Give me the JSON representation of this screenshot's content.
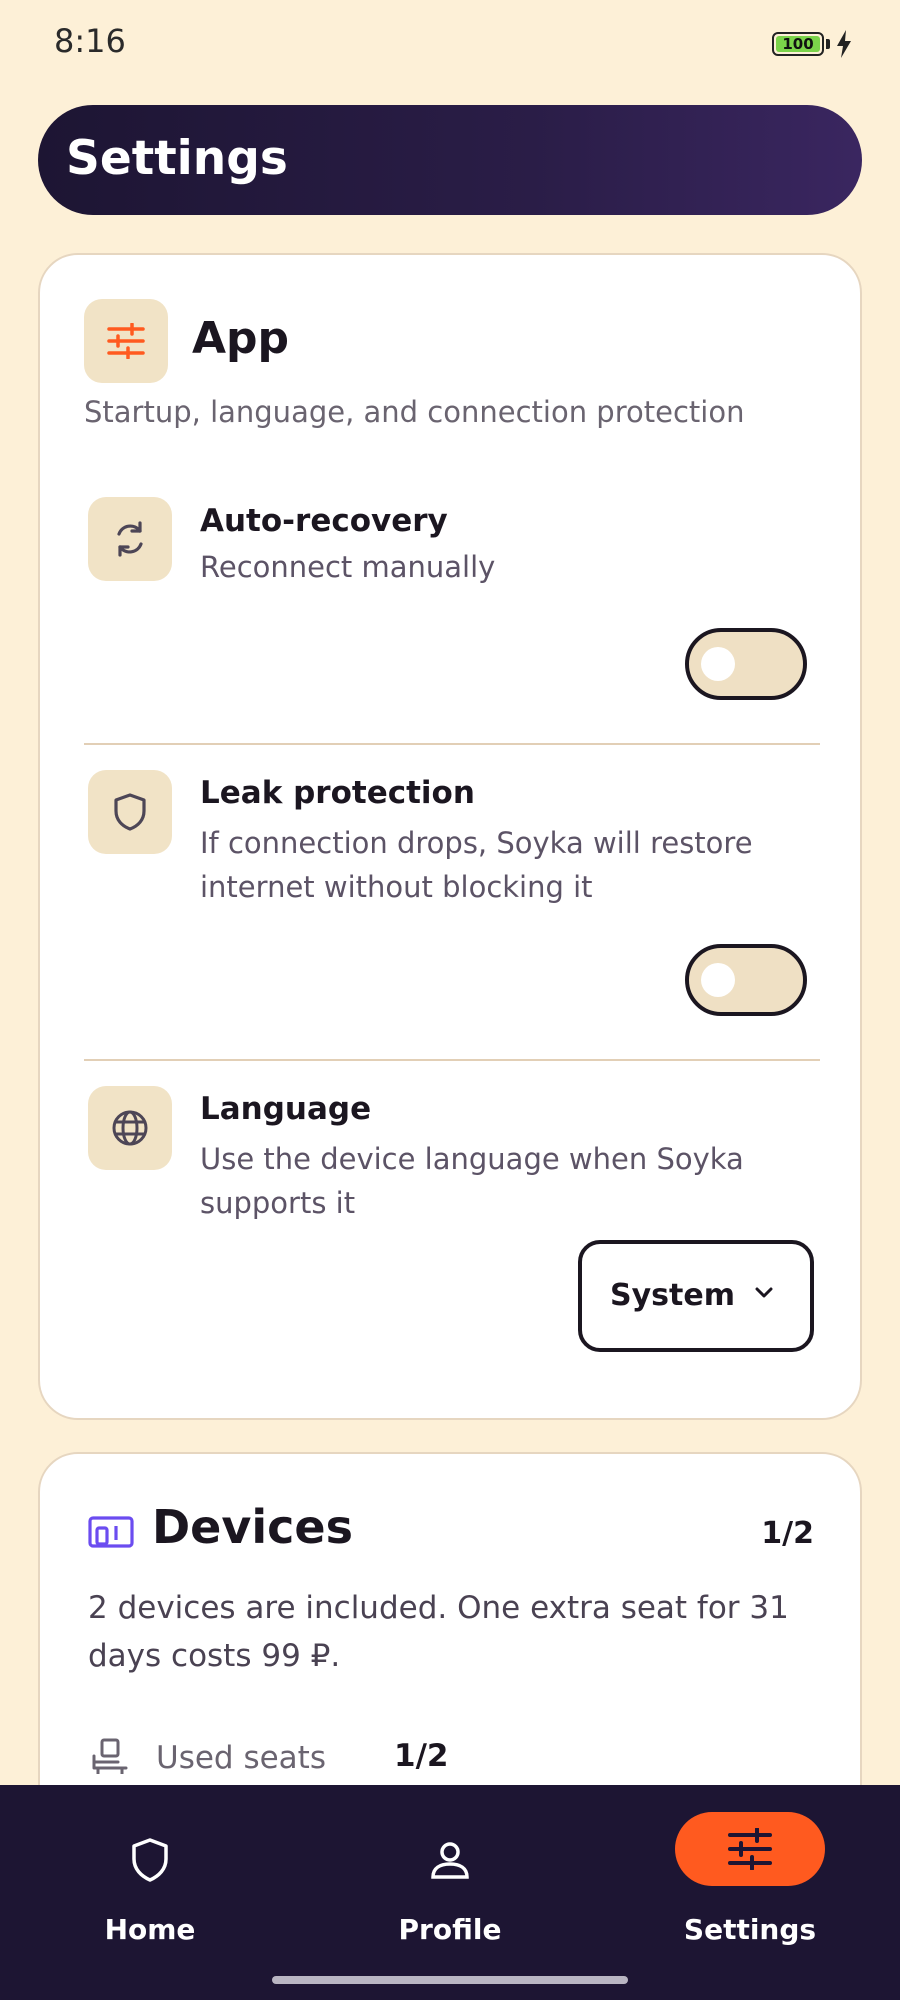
{
  "status_bar": {
    "time": "8:16",
    "battery": "100"
  },
  "header": {
    "title": "Settings"
  },
  "app_section": {
    "title": "App",
    "subtitle": "Startup, language, and connection protection",
    "settings": [
      {
        "title": "Auto-recovery",
        "description": "Reconnect manually",
        "toggle_on": false
      },
      {
        "title": "Leak protection",
        "description": "If connection drops, Soyka will restore internet without blocking it",
        "toggle_on": false
      },
      {
        "title": "Language",
        "description": "Use the device language when Soyka supports it",
        "selected": "System"
      }
    ]
  },
  "devices_section": {
    "title": "Devices",
    "count": "1/2",
    "description": "2 devices are included. One extra seat for 31 days costs 99 ₽.",
    "used_seats_label": "Used seats",
    "used_seats_value": "1/2"
  },
  "bottom_nav": {
    "items": [
      {
        "label": "Home",
        "icon": "shield-icon",
        "active": false
      },
      {
        "label": "Profile",
        "icon": "person-icon",
        "active": false
      },
      {
        "label": "Settings",
        "icon": "sliders-icon",
        "active": true
      }
    ]
  },
  "colors": {
    "background": "#fdf0d7",
    "header": "#1d1533",
    "accent": "#ff5a1f",
    "icon_bg": "#f1e3c6",
    "devices_icon": "#6b4cf0"
  }
}
